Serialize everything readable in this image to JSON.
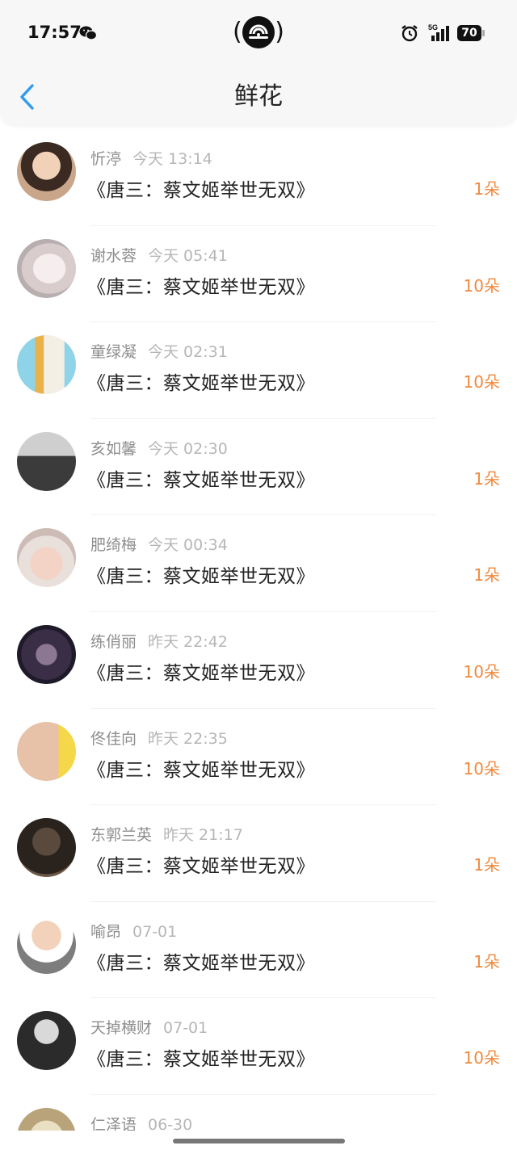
{
  "status": {
    "time": "17:57",
    "battery": "70",
    "network": "5G"
  },
  "header": {
    "title": "鲜花"
  },
  "items": [
    {
      "name": "忻渟",
      "time": "今天 13:14",
      "book": "《唐三：蔡文姬举世无双》",
      "amount": "1朵"
    },
    {
      "name": "谢水蓉",
      "time": "今天 05:41",
      "book": "《唐三：蔡文姬举世无双》",
      "amount": "10朵"
    },
    {
      "name": "童绿凝",
      "time": "今天 02:31",
      "book": "《唐三：蔡文姬举世无双》",
      "amount": "10朵"
    },
    {
      "name": "亥如馨",
      "time": "今天 02:30",
      "book": "《唐三：蔡文姬举世无双》",
      "amount": "1朵"
    },
    {
      "name": "肥绮梅",
      "time": "今天 00:34",
      "book": "《唐三：蔡文姬举世无双》",
      "amount": "1朵"
    },
    {
      "name": "练俏丽",
      "time": "昨天 22:42",
      "book": "《唐三：蔡文姬举世无双》",
      "amount": "10朵"
    },
    {
      "name": "佟佳向",
      "time": "昨天 22:35",
      "book": "《唐三：蔡文姬举世无双》",
      "amount": "10朵"
    },
    {
      "name": "东郭兰英",
      "time": "昨天 21:17",
      "book": "《唐三：蔡文姬举世无双》",
      "amount": "1朵"
    },
    {
      "name": "喻昂",
      "time": "07-01",
      "book": "《唐三：蔡文姬举世无双》",
      "amount": "1朵"
    },
    {
      "name": "天掉横财",
      "time": "07-01",
      "book": "《唐三：蔡文姬举世无双》",
      "amount": "10朵"
    },
    {
      "name": "仁泽语",
      "time": "06-30",
      "book": "",
      "amount": ""
    }
  ],
  "colors": {
    "accent": "#f0893d",
    "back": "#2f9bf0"
  }
}
